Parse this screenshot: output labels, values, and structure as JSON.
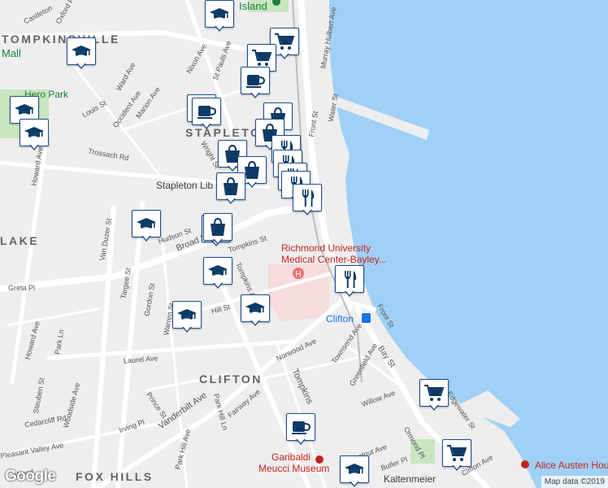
{
  "map": {
    "neighborhoods": [
      "TOMPKINSVILLE",
      "STAPLETON",
      "CLIFTON",
      "FOX HILLS",
      "LAKE"
    ],
    "pois": {
      "island": "Island",
      "mall": "Mall",
      "hero_park": "Hero Park",
      "stapleton_library": "Stapleton Lib",
      "hospital_line1": "Richmond University",
      "hospital_line2": "Medical Center-Bayley...",
      "clifton_station": "Clifton",
      "garibaldi_line1": "Garibaldi",
      "garibaldi_line2": "Meucci Museum",
      "alice_austen": "Alice Austen House",
      "kaltenmeier": "Kaltenmeier"
    },
    "streets": {
      "castleton": "Castleton",
      "oxford_pl": "Oxford Pl",
      "nixon_ave": "Nixon Ave",
      "st_pauls_ave": "St Pauls Ave",
      "murray_hulbert": "Murray Hulbert Ave",
      "water_st": "Water St",
      "front_st_north": "Front St",
      "ward_ave": "Ward Ave",
      "louis_st": "Louis St",
      "occident_ave": "Occident Ave",
      "marion_ave": "Marion Ave",
      "trossach_rd": "Trossach Rd",
      "howard_ave": "Howard Ave",
      "wright_st": "Wright St",
      "van_duzer": "Van Duzer St",
      "targee_st": "Targee St",
      "hudson_st": "Hudson St",
      "broad_st": "Broad St",
      "tompkins_st": "Tompkins St",
      "tompkins_ave": "Tompkins Ave",
      "greta_pl": "Greta Pl",
      "gordon_st": "Gordon St",
      "warren_st": "Warren St",
      "hill_st": "Hill St",
      "laurel_ave": "Laurel Ave",
      "park_ln": "Park Ln",
      "norwood_ave": "Norwood Ave",
      "townsend_ave": "Townsend Ave",
      "greenfield_ave": "Greenfield Ave",
      "front_st_south": "Front St",
      "bay_st": "Bay St",
      "willow_ave": "Willow Ave",
      "vanderbilt_ave": "Vanderbilt Ave",
      "prince_st": "Prince St",
      "fairway_ave": "Fairway Ave",
      "park_hill_ln": "Park Hill Ln",
      "irving_pl": "Irving Pl",
      "park_hill_ave": "Park Hill Ave",
      "cedarcliff_rd": "Cedarcliff Rd",
      "woodside_ave": "Woodside Ave",
      "steuben_st": "Steuben St",
      "pleasant_valley": "Pleasant Valley Ave",
      "ormond_pl": "Ormond Pl",
      "butler_pl": "Butler Pl",
      "chestnut_ave": "Chestnut Ave",
      "clifton_ave": "Clifton Ave",
      "edgewater_st": "Edgewater St",
      "tompkins_south": "Tompkins",
      "woodland": "Wood"
    },
    "attribution": "Map data ©2019",
    "logo": "Google"
  },
  "markers": [
    {
      "icon": "graduation-cap-icon"
    },
    {
      "icon": "graduation-cap-icon"
    },
    {
      "icon": "graduation-cap-icon"
    },
    {
      "icon": "graduation-cap-icon"
    },
    {
      "icon": "shopping-cart-icon"
    },
    {
      "icon": "shopping-cart-icon"
    },
    {
      "icon": "coffee-cup-icon"
    },
    {
      "icon": "coffee-cup-icon"
    },
    {
      "icon": "shopping-bag-icon"
    },
    {
      "icon": "shopping-bag-icon"
    },
    {
      "icon": "shopping-bag-icon"
    },
    {
      "icon": "shopping-bag-icon"
    },
    {
      "icon": "shopping-bag-icon"
    },
    {
      "icon": "coffee-cup-icon"
    },
    {
      "icon": "shopping-bag-icon"
    },
    {
      "icon": "fork-knife-icon"
    },
    {
      "icon": "fork-knife-icon"
    },
    {
      "icon": "fork-knife-icon"
    },
    {
      "icon": "fork-knife-icon"
    },
    {
      "icon": "fork-knife-icon"
    },
    {
      "icon": "graduation-cap-icon"
    },
    {
      "icon": "shopping-bag-icon"
    },
    {
      "icon": "graduation-cap-icon"
    },
    {
      "icon": "fork-knife-icon"
    },
    {
      "icon": "graduation-cap-icon"
    },
    {
      "icon": "graduation-cap-icon"
    },
    {
      "icon": "shopping-cart-icon"
    },
    {
      "icon": "coffee-cup-icon"
    },
    {
      "icon": "shopping-cart-icon"
    },
    {
      "icon": "graduation-cap-icon"
    }
  ],
  "colors": {
    "water": "#a0d0f5",
    "land": "#eeeeee",
    "road": "#ffffff",
    "park": "#c8e6c0",
    "marker_border": "#1f4e8c",
    "marker_icon": "#0d3b66"
  }
}
